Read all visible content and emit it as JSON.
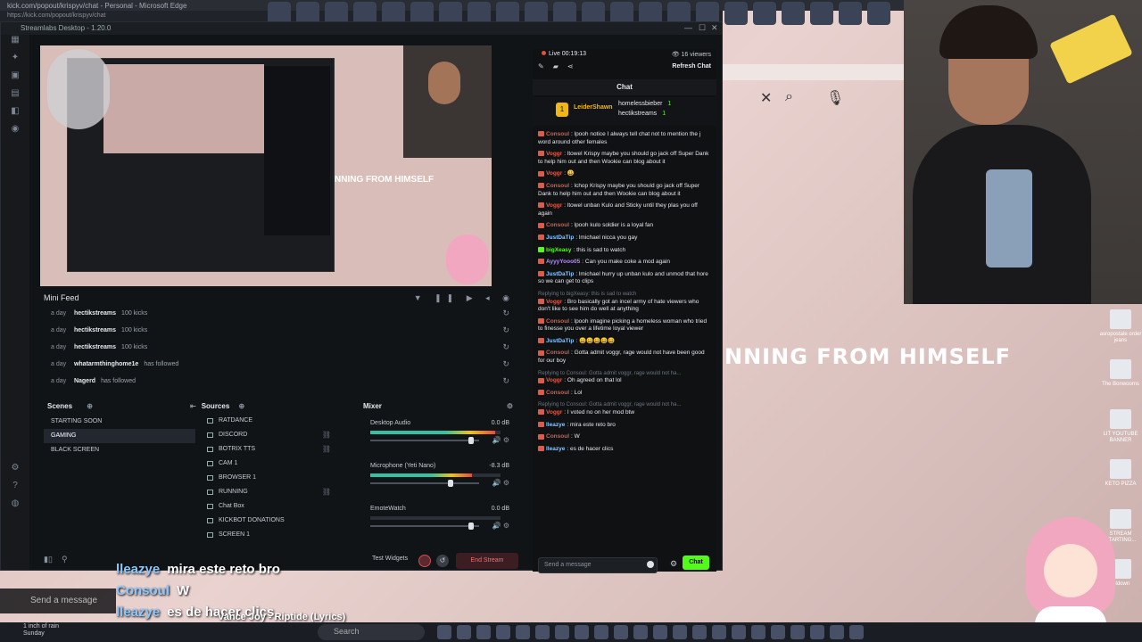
{
  "browser": {
    "title": "kick.com/popout/krispyv/chat - Personal - Microsoft Edge",
    "url": "https://kick.com/popout/krispyv/chat"
  },
  "streamlabs": {
    "title": "Streamlabs Desktop - 1.20.0"
  },
  "background": {
    "overlay_text": "NNING FROM HIMSELF",
    "preview_overlay_text": "NNING FROM HIMSELF",
    "search_close": "✕",
    "search_icon": "⌕",
    "mic_icon": "🎙"
  },
  "minifeed": {
    "title": "Mini Feed",
    "controls": "▼ ❚❚ ▶ ◂ ◉",
    "events": [
      {
        "time": "a day",
        "user": "hectikstreams",
        "event": "100 kicks"
      },
      {
        "time": "a day",
        "user": "hectikstreams",
        "event": "100 kicks"
      },
      {
        "time": "a day",
        "user": "hectikstreams",
        "event": "100 kicks"
      },
      {
        "time": "a day",
        "user": "whatarmthinghome1e",
        "event": "has followed"
      },
      {
        "time": "a day",
        "user": "Nagerd",
        "event": "has followed"
      }
    ]
  },
  "scenes": {
    "title": "Scenes",
    "items": [
      "STARTING SOON",
      "GAMING",
      "BLACK SCREEN"
    ],
    "selected": "GAMING"
  },
  "sources": {
    "title": "Sources",
    "items": [
      "RATDANCE",
      "DISCORD",
      "BOTRIX TTS",
      "CAM 1",
      "BROWSER 1",
      "RUNNING",
      "Chat Box",
      "KICKBOT DONATIONS",
      "SCREEN 1"
    ]
  },
  "mixer": {
    "title": "Mixer",
    "channels": [
      {
        "name": "Desktop Audio",
        "db": "0.0 dB",
        "level": 0.96,
        "volume": 0.95
      },
      {
        "name": "Microphone (Yeti Nano)",
        "db": "-8.3 dB",
        "level": 0.78,
        "volume": 0.75
      },
      {
        "name": "EmoteWatch",
        "db": "0.0 dB",
        "level": 0.0,
        "volume": 0.95
      }
    ]
  },
  "bottom": {
    "test_widgets": "Test Widgets",
    "end_stream": "End Stream"
  },
  "chat": {
    "live_time": "Live 00:19:13",
    "viewers": "16 viewers",
    "refresh": "Refresh Chat",
    "header": "Chat",
    "pinned_top": "LeiderShawn",
    "pinned_list": [
      {
        "name": "homelessbieber",
        "amount": "1"
      },
      {
        "name": "hectikstreams",
        "amount": "1"
      }
    ],
    "messages": [
      {
        "user": "Consoul",
        "color": "#e05a4a",
        "reply": "",
        "text": "lpooh notice I always tell chat not to mention the j word around other females"
      },
      {
        "user": "Voggr",
        "color": "#e05a4a",
        "reply": "",
        "text": "ltowel Krispy maybe you should go jack off Super Dank to help him out and then Wookie can blog about it"
      },
      {
        "user": "Voggr",
        "color": "#e05a4a",
        "reply": "",
        "text": "😀"
      },
      {
        "user": "Consoul",
        "color": "#e05a4a",
        "reply": "",
        "text": "lchop Krispy maybe you should go jack off Super Dank to help him out and then Wookie can blog about it"
      },
      {
        "user": "Voggr",
        "color": "#e05a4a",
        "reply": "",
        "text": "ltowel unban Kulo and Sticky until they plas you off again"
      },
      {
        "user": "Consoul",
        "color": "#e05a4a",
        "reply": "",
        "text": "lpooh kulo soldier is a loyal fan"
      },
      {
        "user": "JustDaTip",
        "color": "#8ac7ff",
        "reply": "",
        "text": "lmichael nicca you gay"
      },
      {
        "user": "bigXeasy",
        "color": "#53fc18",
        "reply": "",
        "text": "this is sad to watch"
      },
      {
        "user": "AyyyYooo05",
        "color": "#b48cff",
        "reply": "",
        "text": "Can you make coke a mod again"
      },
      {
        "user": "JustDaTip",
        "color": "#8ac7ff",
        "reply": "",
        "text": "lmichael hurry up unban kulo and unmod that hore so we can get to clips"
      },
      {
        "user": "Voggr",
        "color": "#e05a4a",
        "reply": "Replying to bigXeasy: this is sad to watch",
        "text": "Bro basically got an incel army of hate viewers who don't like to see him do well at anything"
      },
      {
        "user": "Consoul",
        "color": "#e05a4a",
        "reply": "",
        "text": "lpooh imagine picking a homeless woman who tried to finesse you over a lifetime loyal viewer"
      },
      {
        "user": "JustDaTip",
        "color": "#8ac7ff",
        "reply": "",
        "text": "😀😀😀😀😀"
      },
      {
        "user": "Consoul",
        "color": "#e05a4a",
        "reply": "",
        "text": "Gotta admit voggr, rage would not have been good for our boy"
      },
      {
        "user": "Voggr",
        "color": "#e05a4a",
        "reply": "Replying to Consoul: Gotta admit voggr, rage would not ha...",
        "text": "Oh agreed on that lol"
      },
      {
        "user": "Consoul",
        "color": "#e05a4a",
        "reply": "",
        "text": "Lol"
      },
      {
        "user": "Voggr",
        "color": "#e05a4a",
        "reply": "Replying to Consoul: Gotta admit voggr, rage would not ha...",
        "text": "I voted no on her mod btw"
      },
      {
        "user": "lleazye",
        "color": "#8ac7ff",
        "reply": "",
        "text": "mira este reto bro"
      },
      {
        "user": "Consoul",
        "color": "#e05a4a",
        "reply": "",
        "text": "W"
      },
      {
        "user": "lleazye",
        "color": "#8ac7ff",
        "reply": "",
        "text": "es de hacer clics"
      }
    ],
    "input_placeholder": "Send a message",
    "send_label": "Chat"
  },
  "overlay_chat": [
    {
      "user": "lleazye",
      "text": "mira este reto bro"
    },
    {
      "user": "Consoul",
      "text": "W"
    },
    {
      "user": "lleazye",
      "text": "es de hacer clics"
    }
  ],
  "now_playing": "Vance Joy - Riptide (Lyrics)",
  "taskbar": {
    "weather": "1 inch of rain\nSunday",
    "search": "Search",
    "send_message": "Send a message"
  },
  "right_apps": [
    "asropostale order jeans",
    "The Bonwooms",
    "LIT YOUTUBE BANNER",
    "KETO PIZZA",
    "STREAM STARTING...",
    "Lildown"
  ],
  "colors": {
    "kick_green": "#53fc18",
    "live_red": "#e74c3c",
    "panel_bg": "#111417"
  }
}
